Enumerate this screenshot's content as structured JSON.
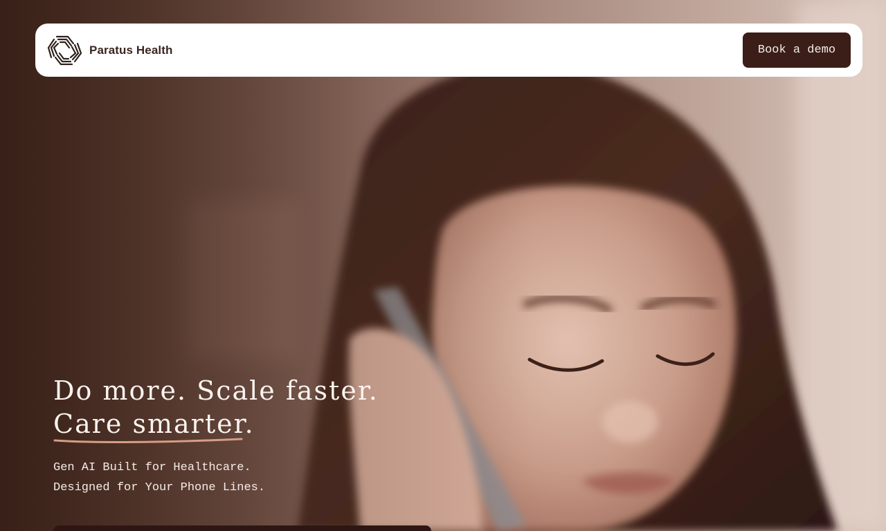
{
  "brand": {
    "name": "Paratus Health",
    "logo_icon": "paratus-logo-icon"
  },
  "nav": {
    "cta_label": "Book a demo"
  },
  "hero": {
    "headline_line1": "Do more. Scale faster.",
    "headline_line2": "Care smarter.",
    "subhead_line1": "Gen AI Built for Healthcare.",
    "subhead_line2": "Designed for Your Phone Lines.",
    "background_image": "woman-on-phone-photo"
  },
  "colors": {
    "brand_dark": "#3b1e17",
    "accent_underline": "#d69d86",
    "hero_text": "#fbf3ef"
  }
}
